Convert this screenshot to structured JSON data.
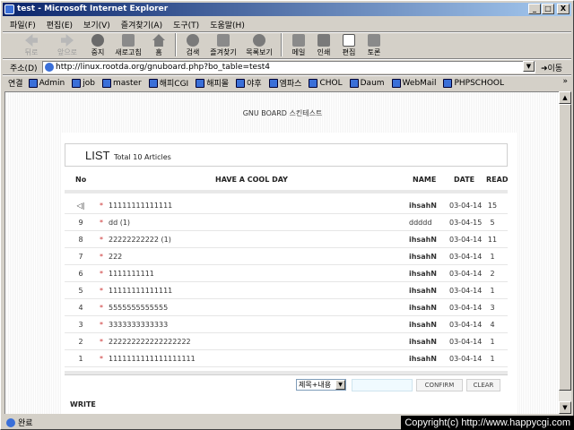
{
  "window": {
    "title": "test - Microsoft Internet Explorer",
    "min_label": "_",
    "max_label": "□",
    "close_label": "X"
  },
  "menu": [
    "파일(F)",
    "편집(E)",
    "보기(V)",
    "즐겨찾기(A)",
    "도구(T)",
    "도움말(H)"
  ],
  "toolbar": {
    "back": "뒤로",
    "forward": "앞으로",
    "stop": "중지",
    "refresh": "새로고침",
    "home": "홈",
    "search": "검색",
    "favorites": "즐겨찾기",
    "history": "목록보기",
    "mail": "메일",
    "print": "인쇄",
    "edit": "편집",
    "discuss": "토론"
  },
  "address": {
    "label": "주소(D)",
    "url": "http://linux.rootda.org/gnuboard.php?bo_table=test4",
    "go": "이동"
  },
  "links": {
    "label": "연결",
    "items": [
      "Admin",
      "job",
      "master",
      "해피CGI",
      "해피몰",
      "야후",
      "엠파스",
      "CHOL",
      "Daum",
      "WebMail",
      "PHPSCHOOL"
    ],
    "more": "»"
  },
  "board": {
    "title": "GNU BOARD 스킨테스트",
    "list_label": "LIST",
    "total_label": "Total 10 Articles",
    "columns": {
      "no": "No",
      "subject": "HAVE A COOL DAY",
      "name": "NAME",
      "date": "DATE",
      "read": "READ"
    },
    "rows": [
      {
        "no": "◁|",
        "subject": "11111111111111",
        "name": "ihsahN",
        "date": "03-04-14",
        "read": "15"
      },
      {
        "no": "9",
        "subject": "dd  (1)",
        "name": "ddddd",
        "date": "03-04-15",
        "read": "5"
      },
      {
        "no": "8",
        "subject": "22222222222  (1)",
        "name": "ihsahN",
        "date": "03-04-14",
        "read": "11"
      },
      {
        "no": "7",
        "subject": "222",
        "name": "ihsahN",
        "date": "03-04-14",
        "read": "1"
      },
      {
        "no": "6",
        "subject": "1111111111",
        "name": "ihsahN",
        "date": "03-04-14",
        "read": "2"
      },
      {
        "no": "5",
        "subject": "11111111111111",
        "name": "ihsahN",
        "date": "03-04-14",
        "read": "1"
      },
      {
        "no": "4",
        "subject": "5555555555555",
        "name": "ihsahN",
        "date": "03-04-14",
        "read": "3"
      },
      {
        "no": "3",
        "subject": "3333333333333",
        "name": "ihsahN",
        "date": "03-04-14",
        "read": "4"
      },
      {
        "no": "2",
        "subject": "222222222222222222",
        "name": "ihsahN",
        "date": "03-04-14",
        "read": "1"
      },
      {
        "no": "1",
        "subject": "1111111111111111111",
        "name": "ihsahN",
        "date": "03-04-14",
        "read": "1"
      }
    ],
    "search_select": "제목+내용",
    "search_value": "",
    "confirm": "CONFIRM",
    "clear": "CLEAR",
    "write": "WRITE"
  },
  "status": {
    "text": "완료",
    "copyright": "Copyright(c) http://www.happycgi.com"
  },
  "colors": {
    "titlebar": "#0a246a",
    "accent_star": "#cc3333"
  }
}
